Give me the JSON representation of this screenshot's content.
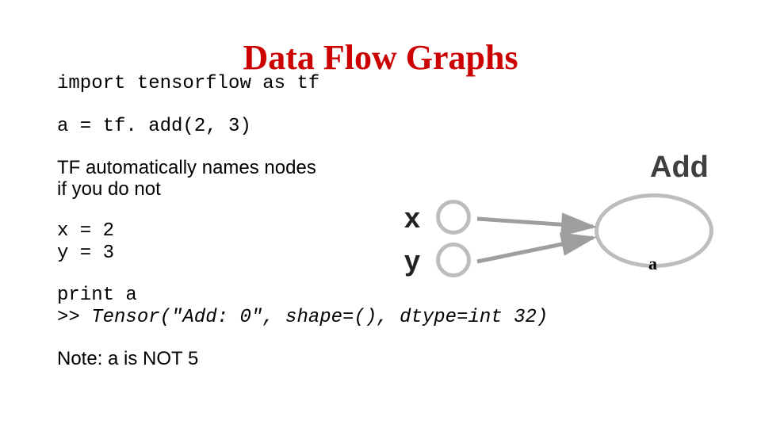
{
  "title": "Data Flow Graphs",
  "code": {
    "import": "import tensorflow as tf",
    "assign_a": "a = tf. add(2, 3)",
    "x_line": "x = 2",
    "y_line": "y = 3",
    "print_line": "print a",
    "output_line": ">> Tensor(\"Add: 0\", shape=(), dtype=int 32)"
  },
  "text": {
    "autoname_l1": "TF automatically names nodes",
    "autoname_l2": "if you do not",
    "note": "Note: a is NOT 5"
  },
  "diagram": {
    "add_label": "Add",
    "x_label": "x",
    "y_label": "y",
    "a_label": "a"
  }
}
